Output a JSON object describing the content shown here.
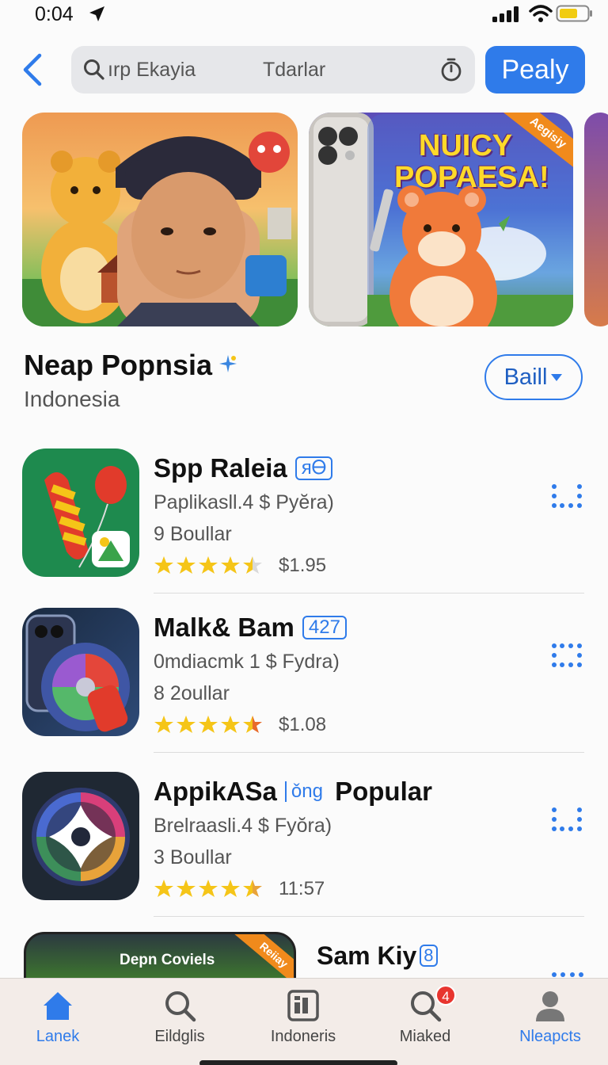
{
  "status_bar": {
    "time": "0:04"
  },
  "header": {
    "search_query": "ırp Ekayia",
    "search_secondary": "Tdarlar",
    "primary_button": "Pealy"
  },
  "banners": [
    {
      "title": ""
    },
    {
      "title": "NUICY POPAESA!",
      "ribbon": "Aegisiy"
    },
    {
      "title": ""
    }
  ],
  "section": {
    "title": "Neap Popnsia",
    "subtitle": "Indonesia",
    "filter_label": "Baill"
  },
  "apps": [
    {
      "name": "Spp Raleia",
      "badge": "ᴙᎾ",
      "meta": "Paplikasll.4 $ Pyĕra)",
      "size": "9 Boullar",
      "rating": 4.5,
      "price": "$1.95"
    },
    {
      "name": "Malk& Bam",
      "badge": "427",
      "meta": "0mdiacmk 1 $ Fydra)",
      "size": "8 2oullar",
      "rating": 4.5,
      "price": "$1.08"
    },
    {
      "name": "AppikASa",
      "badge": "ǒng",
      "name_suffix": "Popular",
      "meta": "Brelraasli.4 $ Fyŏra)",
      "size": "3 Boullar",
      "rating": 4.5,
      "price": "11:57"
    }
  ],
  "partial_app": {
    "name": "Sam Kiy",
    "badge": "8",
    "thumb_label": "Depn Coviels",
    "ribbon": "Reiiay"
  },
  "tab_bar": [
    {
      "label": "Lanek",
      "icon": "home-icon",
      "active": true
    },
    {
      "label": "Eildglis",
      "icon": "search-icon",
      "active": false
    },
    {
      "label": "Indoneris",
      "icon": "apps-icon",
      "active": false
    },
    {
      "label": "Miaked",
      "icon": "search-badge-icon",
      "badge": "4",
      "active": false
    },
    {
      "label": "Nleapcts",
      "icon": "profile-icon",
      "active": true
    }
  ],
  "colors": {
    "accent": "#2f7bea",
    "star": "#f5c518",
    "tab_bar_bg": "#f3ece8"
  }
}
